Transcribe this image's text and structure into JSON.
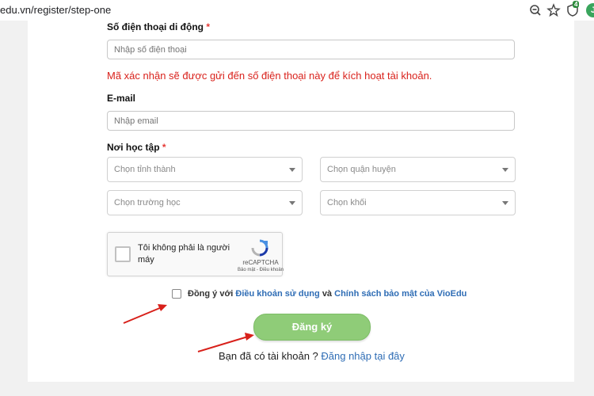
{
  "browser": {
    "url": "edu.vn/register/step-one",
    "extension_badge": "4",
    "profile_initial": "J"
  },
  "form": {
    "phone": {
      "label": "Số điện thoại di động",
      "required_mark": "*",
      "placeholder": "Nhập số điện thoại"
    },
    "phone_notice": "Mã xác nhận sẽ được gửi đến số điện thoại này để kích hoạt tài khoản.",
    "email": {
      "label": "E-mail",
      "placeholder": "Nhập email"
    },
    "school": {
      "label": "Nơi học tập",
      "required_mark": "*",
      "province": "Chọn tỉnh thành",
      "district": "Chọn quận huyện",
      "school_select": "Chọn trường học",
      "grade": "Chọn khối"
    },
    "captcha": {
      "label": "Tôi không phải là người máy",
      "brand": "reCAPTCHA",
      "footer": "Bảo mật - Điều khoản"
    },
    "agreement": {
      "prefix": "Đồng ý với",
      "terms_link": "Điều khoản sử dụng",
      "conjunction": "và",
      "privacy_link": "Chính sách bảo mật của VioEdu",
      "checked": false
    },
    "submit_label": "Đăng ký",
    "login_prompt": "Bạn đã có tài khoản ?",
    "login_link": "Đăng nhập tại đây"
  },
  "colors": {
    "required": "#e53935",
    "notice": "#d9221c",
    "link": "#2f6db5",
    "submit_button": "#8fcc78",
    "annotation_arrow": "#d8201a"
  }
}
